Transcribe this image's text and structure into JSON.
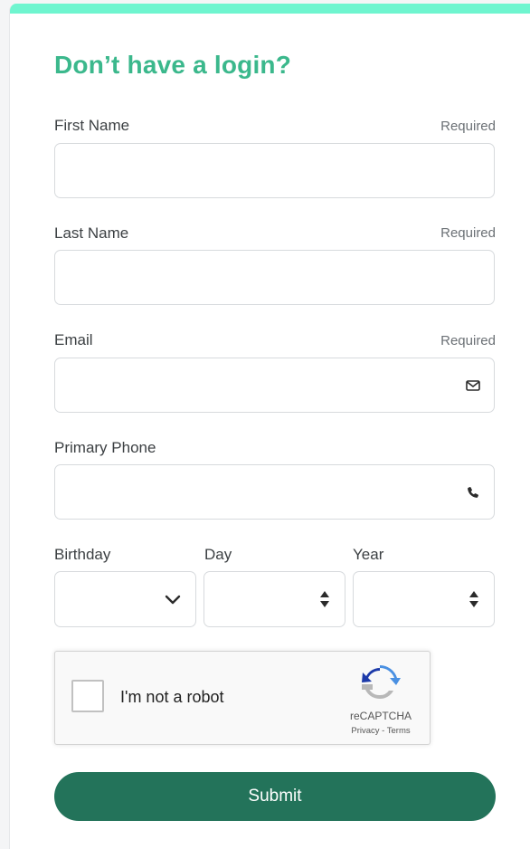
{
  "form": {
    "title": "Don’t have a login?",
    "required_text": "Required",
    "fields": {
      "first_name": {
        "label": "First Name",
        "value": ""
      },
      "last_name": {
        "label": "Last Name",
        "value": ""
      },
      "email": {
        "label": "Email",
        "value": "",
        "icon": "envelope-icon"
      },
      "phone": {
        "label": "Primary Phone",
        "value": "",
        "icon": "phone-icon"
      }
    },
    "birthday": {
      "month_label": "Birthday",
      "day_label": "Day",
      "year_label": "Year",
      "month_value": "",
      "day_value": "",
      "year_value": ""
    },
    "recaptcha": {
      "checkbox_label": "I'm not a robot",
      "brand": "reCAPTCHA",
      "links": "Privacy - Terms"
    },
    "submit_label": "Submit"
  },
  "colors": {
    "accent_bar": "#6ff5cf",
    "title": "#3bb88c",
    "submit_bg": "#23735a"
  }
}
